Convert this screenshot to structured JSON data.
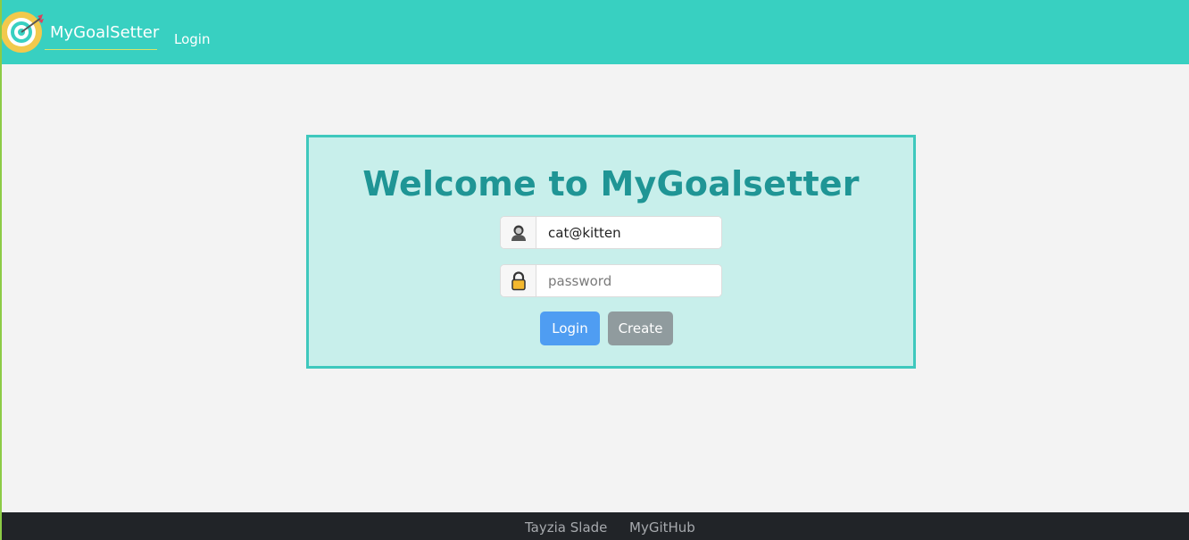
{
  "navbar": {
    "brand": "MyGoalSetter",
    "login_link": "Login",
    "logo_icon": "target-arrow-icon",
    "background": "#38d0c1"
  },
  "login_card": {
    "title": "Welcome to MyGoalsetter",
    "email": {
      "icon": "user-icon",
      "value": "cat@kitten"
    },
    "password": {
      "icon": "lock-icon",
      "value": "",
      "placeholder": "password"
    },
    "login_button": "Login",
    "create_button": "Create",
    "background": "#c8efeb",
    "border_color": "#3ec8bd",
    "title_color": "#1f9595"
  },
  "footer": {
    "author": "Tayzia Slade",
    "github": "MyGitHub",
    "background": "#212428"
  }
}
